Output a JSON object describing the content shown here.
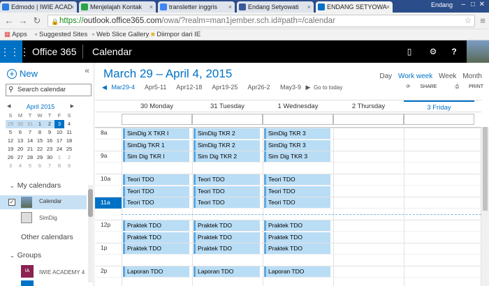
{
  "browser": {
    "tabs": [
      {
        "title": "Edmodo | IWIE ACAD",
        "icon_color": "#2a7de1"
      },
      {
        "title": "Menjelajah Kontak",
        "icon_color": "#2aa54b"
      },
      {
        "title": "transletter inggris",
        "icon_color": "#4285f4"
      },
      {
        "title": "Endang Setyowati",
        "icon_color": "#3b5998"
      },
      {
        "title": "ENDANG SETYOWA",
        "icon_color": "#0072c6"
      }
    ],
    "profile_name": "Endang",
    "url_https": "https://",
    "url_host": "outlook.office365.com",
    "url_path": "/owa/?realm=man1jember.sch.id#path=/calendar",
    "bookmarks": [
      "Apps",
      "Suggested Sites",
      "Web Slice Gallery",
      "Diimpor dari IE"
    ]
  },
  "o365": {
    "brand": "Office 365",
    "app": "Calendar"
  },
  "sidebar": {
    "new_label": "New",
    "search_placeholder": "Search calendar",
    "mini_cal": {
      "title": "April 2015",
      "day_headers": [
        "S",
        "M",
        "T",
        "W",
        "T",
        "F",
        "S"
      ],
      "weeks": [
        [
          "29",
          "30",
          "31",
          "1",
          "2",
          "3",
          "4"
        ],
        [
          "5",
          "6",
          "7",
          "8",
          "9",
          "10",
          "11"
        ],
        [
          "12",
          "13",
          "14",
          "15",
          "16",
          "17",
          "18"
        ],
        [
          "19",
          "20",
          "21",
          "22",
          "23",
          "24",
          "25"
        ],
        [
          "26",
          "27",
          "28",
          "29",
          "30",
          "1",
          "2"
        ],
        [
          "3",
          "4",
          "5",
          "6",
          "7",
          "8",
          "9"
        ]
      ]
    },
    "my_calendars": "My calendars",
    "calendar_label": "Calendar",
    "simdig_label": "SimDig",
    "other_calendars": "Other calendars",
    "groups": "Groups",
    "group_item": "IWIE ACADEMY 4",
    "group_initials": "IA"
  },
  "main": {
    "date_range": "March 29 – April 4, 2015",
    "views": [
      "Day",
      "Work week",
      "Week",
      "Month"
    ],
    "active_view": "Work week",
    "weeks": [
      "Mar29-4",
      "Apr5-11",
      "Apr12-18",
      "Apr19-25",
      "Apr26-2",
      "May3-9"
    ],
    "go_today": "Go to today",
    "share": "SHARE",
    "print": "PRINT",
    "days": [
      "30 Monday",
      "31 Tuesday",
      "1 Wednesday",
      "2 Thursday",
      "3 Friday"
    ],
    "time_labels": [
      "8a",
      "9a",
      "10a",
      "11a",
      "12p",
      "1p",
      "2p"
    ],
    "events": [
      {
        "day": 0,
        "slot": 0,
        "title": "SimDig X TKR I"
      },
      {
        "day": 0,
        "slot": 1,
        "title": "SimDig TKR 1"
      },
      {
        "day": 0,
        "slot": 2,
        "title": "Sim Dig TKR I"
      },
      {
        "day": 1,
        "slot": 0,
        "title": "SimDig TKR 2"
      },
      {
        "day": 1,
        "slot": 1,
        "title": "SimDig TKR 2"
      },
      {
        "day": 1,
        "slot": 2,
        "title": "Sim Dig TKR 2"
      },
      {
        "day": 2,
        "slot": 0,
        "title": "SimDig TKR 3"
      },
      {
        "day": 2,
        "slot": 1,
        "title": "SimDig TKR 3"
      },
      {
        "day": 2,
        "slot": 2,
        "title": "Sim Dig TKR 3"
      },
      {
        "day": 0,
        "slot": 4,
        "title": "Teori TDO"
      },
      {
        "day": 0,
        "slot": 5,
        "title": "Teori TDO"
      },
      {
        "day": 0,
        "slot": 6,
        "title": "Teori TDO"
      },
      {
        "day": 1,
        "slot": 4,
        "title": "Teori TDO"
      },
      {
        "day": 1,
        "slot": 5,
        "title": "Teori TDO"
      },
      {
        "day": 1,
        "slot": 6,
        "title": "Teori TDO"
      },
      {
        "day": 2,
        "slot": 4,
        "title": "Teori TDO"
      },
      {
        "day": 2,
        "slot": 5,
        "title": "Teori TDO"
      },
      {
        "day": 2,
        "slot": 6,
        "title": "Teori TDO"
      },
      {
        "day": 0,
        "slot": 8,
        "title": "Praktek TDO"
      },
      {
        "day": 0,
        "slot": 9,
        "title": "Praktek TDO"
      },
      {
        "day": 0,
        "slot": 10,
        "title": "Praktek TDO"
      },
      {
        "day": 1,
        "slot": 8,
        "title": "Praktek TDO"
      },
      {
        "day": 1,
        "slot": 9,
        "title": "Praktek TDO"
      },
      {
        "day": 1,
        "slot": 10,
        "title": "Praktek TDO"
      },
      {
        "day": 2,
        "slot": 8,
        "title": "Praktek TDO"
      },
      {
        "day": 2,
        "slot": 9,
        "title": "Praktek TDO"
      },
      {
        "day": 2,
        "slot": 10,
        "title": "Praktek TDO"
      },
      {
        "day": 0,
        "slot": 12,
        "title": "Laporan TDO"
      },
      {
        "day": 1,
        "slot": 12,
        "title": "Laporan TDO"
      },
      {
        "day": 2,
        "slot": 12,
        "title": "Laporan TDO"
      }
    ]
  }
}
